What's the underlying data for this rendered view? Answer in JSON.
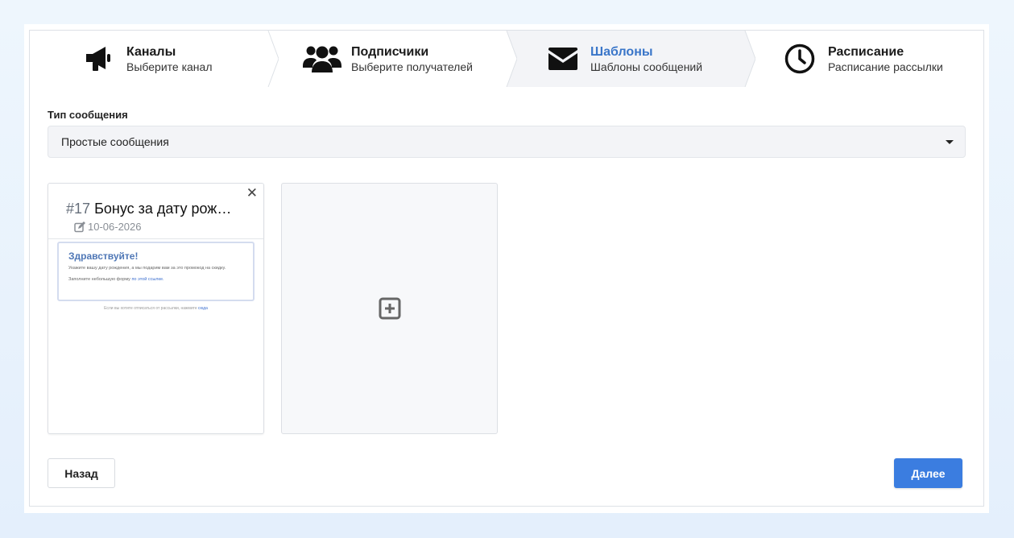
{
  "steps": [
    {
      "title": "Каналы",
      "subtitle": "Выберите канал",
      "icon": "megaphone-icon"
    },
    {
      "title": "Подписчики",
      "subtitle": "Выберите получателей",
      "icon": "users-icon"
    },
    {
      "title": "Шаблоны",
      "subtitle": "Шаблоны сообщений",
      "icon": "envelope-icon",
      "active": true
    },
    {
      "title": "Расписание",
      "subtitle": "Расписание рассылки",
      "icon": "clock-icon"
    }
  ],
  "message_type": {
    "label": "Тип сообщения",
    "selected": "Простые сообщения"
  },
  "template": {
    "number": "#17",
    "name": "Бонус за дату рождения",
    "date": "10-06-2026",
    "close": "✕",
    "preview": {
      "greeting": "Здравствуйте!",
      "line1": "Укажите вашу дату рождения, а мы подарим вам за это промокод на скидку.",
      "line2_prefix": "Заполните небольшую форму",
      "line2_link": "по этой ссылке.",
      "unsubscribe_prefix": "Если вы хотите отписаться от рассылки, нажмите",
      "unsubscribe_link": "сюда"
    }
  },
  "buttons": {
    "back": "Назад",
    "next": "Далее"
  },
  "colors": {
    "accent": "#3b7de0",
    "active_step_title": "#3a76c9",
    "active_step_bg": "#f3f4f7"
  }
}
